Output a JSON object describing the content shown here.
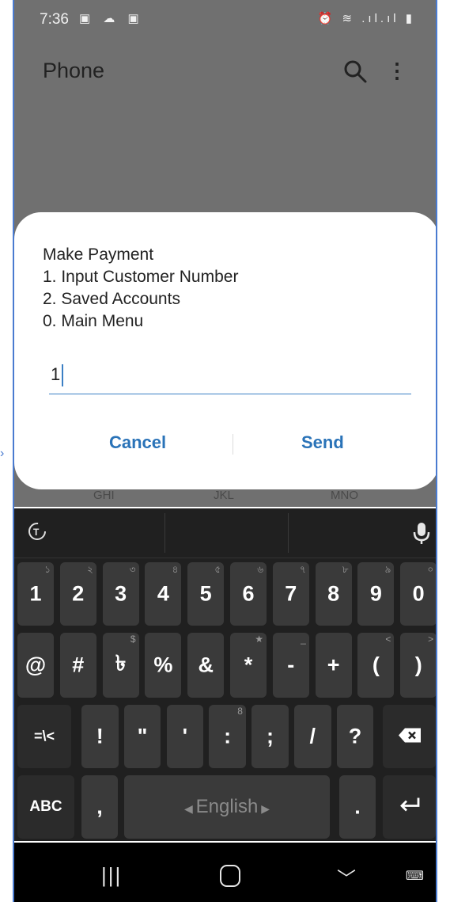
{
  "status": {
    "time": "7:36",
    "notif_icons": "▣ ☁ ▣",
    "right_icons": "⏰ ≋ .ıl.ıl ▮"
  },
  "appbar": {
    "title": "Phone"
  },
  "keypad_letters": [
    "GHI",
    "JKL",
    "MNO"
  ],
  "dialog": {
    "message": "Make Payment\n1. Input Customer Number\n2. Saved Accounts\n0. Main Menu",
    "input_value": "1",
    "cancel_label": "Cancel",
    "send_label": "Send"
  },
  "keyboard": {
    "row1": [
      {
        "main": "1",
        "sub": "১"
      },
      {
        "main": "2",
        "sub": "২"
      },
      {
        "main": "3",
        "sub": "৩"
      },
      {
        "main": "4",
        "sub": "৪"
      },
      {
        "main": "5",
        "sub": "৫"
      },
      {
        "main": "6",
        "sub": "৬"
      },
      {
        "main": "7",
        "sub": "৭"
      },
      {
        "main": "8",
        "sub": "৮"
      },
      {
        "main": "9",
        "sub": "৯"
      },
      {
        "main": "0",
        "sub": "০"
      }
    ],
    "row2": [
      {
        "main": "@",
        "sub": ""
      },
      {
        "main": "#",
        "sub": ""
      },
      {
        "main": "৳",
        "sub": "$"
      },
      {
        "main": "%",
        "sub": ""
      },
      {
        "main": "&",
        "sub": ""
      },
      {
        "main": "*",
        "sub": "★"
      },
      {
        "main": "-",
        "sub": "_"
      },
      {
        "main": "+",
        "sub": ""
      },
      {
        "main": "(",
        "sub": "<"
      },
      {
        "main": ")",
        "sub": ">"
      }
    ],
    "row3": [
      {
        "main": "=\\<",
        "sub": ""
      },
      {
        "main": "!",
        "sub": ""
      },
      {
        "main": "\"",
        "sub": ""
      },
      {
        "main": "'",
        "sub": ""
      },
      {
        "main": ":",
        "sub": "8"
      },
      {
        "main": ";",
        "sub": ""
      },
      {
        "main": "/",
        "sub": ""
      },
      {
        "main": "?",
        "sub": ""
      }
    ],
    "abc_label": "ABC",
    "comma_label": ",",
    "space_label": "English",
    "period_label": "."
  }
}
